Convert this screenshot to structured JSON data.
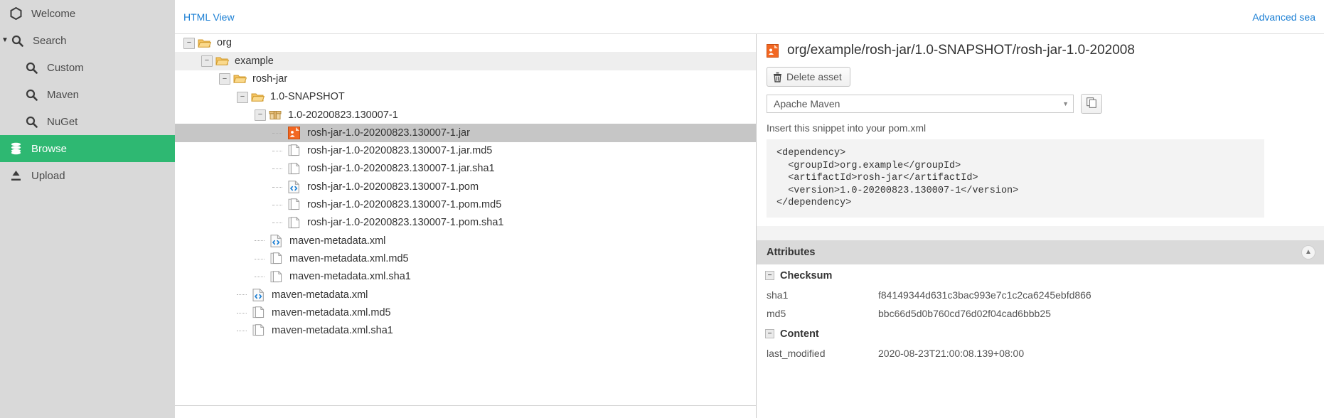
{
  "sidebar": {
    "items": [
      {
        "label": "Welcome",
        "icon": "hexagon-icon",
        "level": 0,
        "active": false,
        "caret": ""
      },
      {
        "label": "Search",
        "icon": "search-icon",
        "level": 0,
        "active": false,
        "caret": "▼"
      },
      {
        "label": "Custom",
        "icon": "search-icon",
        "level": 1,
        "active": false,
        "caret": ""
      },
      {
        "label": "Maven",
        "icon": "search-icon",
        "level": 1,
        "active": false,
        "caret": ""
      },
      {
        "label": "NuGet",
        "icon": "search-icon",
        "level": 1,
        "active": false,
        "caret": ""
      },
      {
        "label": "Browse",
        "icon": "database-icon",
        "level": 0,
        "active": true,
        "caret": ""
      },
      {
        "label": "Upload",
        "icon": "upload-icon",
        "level": 0,
        "active": false,
        "caret": ""
      }
    ],
    "active_color": "#2eb872",
    "background": "#d9d9d9"
  },
  "topbar": {
    "view_link": "HTML View",
    "advanced_search": "Advanced sea"
  },
  "tree": {
    "rows": [
      {
        "label": "org",
        "icon": "folder-open-icon",
        "depth": 0,
        "expander": "−",
        "state": "normal"
      },
      {
        "label": "example",
        "icon": "folder-open-icon",
        "depth": 1,
        "expander": "−",
        "state": "alt"
      },
      {
        "label": "rosh-jar",
        "icon": "folder-open-icon",
        "depth": 2,
        "expander": "−",
        "state": "normal"
      },
      {
        "label": "1.0-SNAPSHOT",
        "icon": "folder-open-icon",
        "depth": 3,
        "expander": "−",
        "state": "normal"
      },
      {
        "label": "1.0-20200823.130007-1",
        "icon": "package-icon",
        "depth": 4,
        "expander": "−",
        "state": "normal"
      },
      {
        "label": "rosh-jar-1.0-20200823.130007-1.jar",
        "icon": "jar-icon",
        "depth": 5,
        "expander": "",
        "state": "selected"
      },
      {
        "label": "rosh-jar-1.0-20200823.130007-1.jar.md5",
        "icon": "file-icon",
        "depth": 5,
        "expander": "",
        "state": "normal"
      },
      {
        "label": "rosh-jar-1.0-20200823.130007-1.jar.sha1",
        "icon": "file-icon",
        "depth": 5,
        "expander": "",
        "state": "normal"
      },
      {
        "label": "rosh-jar-1.0-20200823.130007-1.pom",
        "icon": "xml-icon",
        "depth": 5,
        "expander": "",
        "state": "normal"
      },
      {
        "label": "rosh-jar-1.0-20200823.130007-1.pom.md5",
        "icon": "file-icon",
        "depth": 5,
        "expander": "",
        "state": "normal"
      },
      {
        "label": "rosh-jar-1.0-20200823.130007-1.pom.sha1",
        "icon": "file-icon",
        "depth": 5,
        "expander": "",
        "state": "normal"
      },
      {
        "label": "maven-metadata.xml",
        "icon": "xml-icon",
        "depth": 4,
        "expander": "",
        "state": "normal"
      },
      {
        "label": "maven-metadata.xml.md5",
        "icon": "file-icon",
        "depth": 4,
        "expander": "",
        "state": "normal"
      },
      {
        "label": "maven-metadata.xml.sha1",
        "icon": "file-icon",
        "depth": 4,
        "expander": "",
        "state": "normal"
      },
      {
        "label": "maven-metadata.xml",
        "icon": "xml-icon",
        "depth": 3,
        "expander": "",
        "state": "normal"
      },
      {
        "label": "maven-metadata.xml.md5",
        "icon": "file-icon",
        "depth": 3,
        "expander": "",
        "state": "normal"
      },
      {
        "label": "maven-metadata.xml.sha1",
        "icon": "file-icon",
        "depth": 3,
        "expander": "",
        "state": "normal"
      }
    ]
  },
  "detail": {
    "title": "org/example/rosh-jar/1.0-SNAPSHOT/rosh-jar-1.0-202008",
    "title_icon": "jar-icon",
    "delete_button": "Delete asset",
    "delete_icon": "trash-icon",
    "format_select_value": "Apache Maven",
    "copy_icon": "copy-icon",
    "snippet_hint": "Insert this snippet into your pom.xml",
    "snippet": "<dependency>\n  <groupId>org.example</groupId>\n  <artifactId>rosh-jar</artifactId>\n  <version>1.0-20200823.130007-1</version>\n</dependency>",
    "attributes_header": "Attributes",
    "collapse_icon": "chevron-up-icon",
    "groups": [
      {
        "name": "Checksum",
        "toggle": "−",
        "rows": [
          {
            "key": "sha1",
            "value": "f84149344d631c3bac993e7c1c2ca6245ebfd866"
          },
          {
            "key": "md5",
            "value": "bbc66d5d0b760cd76d02f04cad6bbb25"
          }
        ]
      },
      {
        "name": "Content",
        "toggle": "−",
        "rows": [
          {
            "key": "last_modified",
            "value": "2020-08-23T21:00:08.139+08:00"
          }
        ]
      }
    ]
  }
}
